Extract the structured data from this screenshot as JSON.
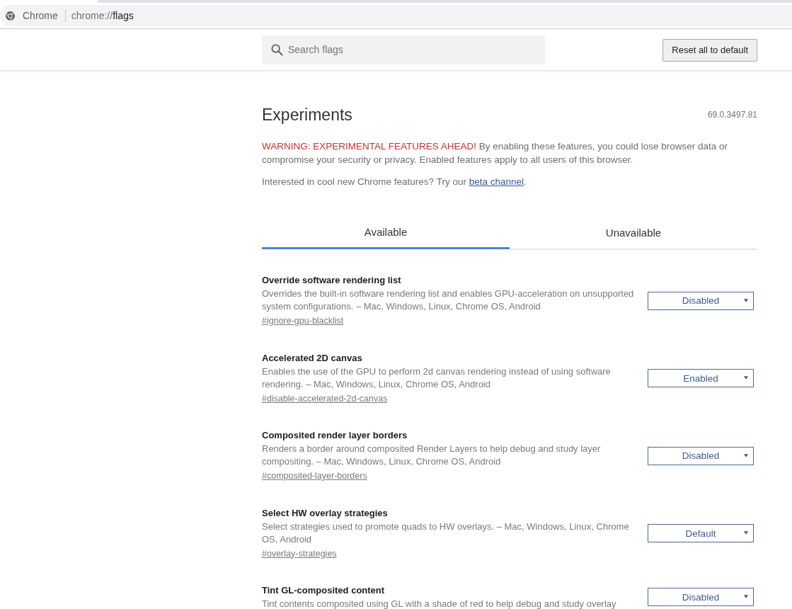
{
  "browser": {
    "site_label": "Chrome",
    "url": {
      "scheme": "chrome://",
      "path": "flags"
    }
  },
  "header": {
    "search": {
      "placeholder": "Search flags"
    },
    "reset_button": "Reset all to default"
  },
  "page": {
    "title": "Experiments",
    "version": "69.0.3497.81",
    "warning": {
      "label": "WARNING: EXPERIMENTAL FEATURES AHEAD!",
      "text": "By enabling these features, you could lose browser data or compromise your security or privacy. Enabled features apply to all users of this browser."
    },
    "beta_note": {
      "text": "Interested in cool new Chrome features? Try our",
      "link": "beta channel",
      "after": "."
    }
  },
  "tabs": [
    {
      "label": "Available",
      "selected": true
    },
    {
      "label": "Unavailable",
      "selected": false
    }
  ],
  "flags": [
    {
      "title": "Override software rendering list",
      "description": "Overrides the built-in software rendering list and enables GPU-acceleration on unsupported system configurations. – Mac, Windows, Linux, Chrome OS, Android",
      "link": "#ignore-gpu-blacklist",
      "value": "Disabled"
    },
    {
      "title": "Accelerated 2D canvas",
      "description": "Enables the use of the GPU to perform 2d canvas rendering instead of using software rendering. – Mac, Windows, Linux, Chrome OS, Android",
      "link": "#disable-accelerated-2d-canvas",
      "value": "Enabled"
    },
    {
      "title": "Composited render layer borders",
      "description": "Renders a border around composited Render Layers to help debug and study layer compositing. – Mac, Windows, Linux, Chrome OS, Android",
      "link": "#composited-layer-borders",
      "value": "Disabled"
    },
    {
      "title": "Select HW overlay strategies",
      "description": "Select strategies used to promote quads to HW overlays. – Mac, Windows, Linux, Chrome OS, Android",
      "link": "#overlay-strategies",
      "value": "Default"
    },
    {
      "title": "Tint GL-composited content",
      "description": "Tint contents composited using GL with a shade of red to help debug and study overlay",
      "value": "Disabled"
    }
  ]
}
